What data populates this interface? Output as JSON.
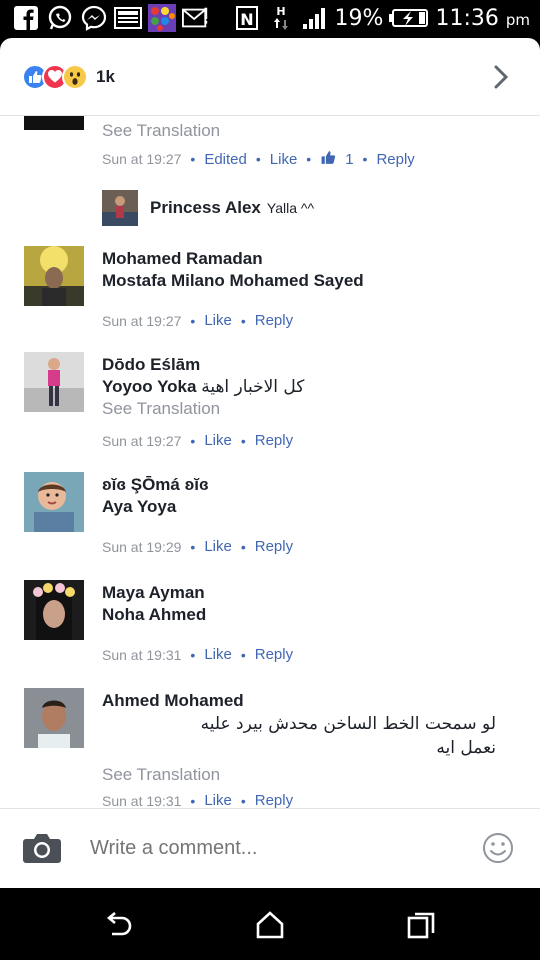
{
  "status_bar": {
    "battery": "19%",
    "time": "11:36",
    "ampm": "pm",
    "icons": [
      "facebook-icon",
      "whatsapp-icon",
      "messenger-icon",
      "news-icon",
      "game-icon",
      "mail-icon",
      "nfc-icon",
      "data-icon",
      "signal-icon",
      "battery-icon"
    ]
  },
  "header": {
    "reaction_count": "1k",
    "reactions": [
      "like",
      "love",
      "wow"
    ]
  },
  "comments": [
    {
      "see_translation": "See Translation",
      "time": "Sun at 19:27",
      "edited": "Edited",
      "like": "Like",
      "like_count": "1",
      "reply": "Reply"
    },
    {
      "name": "Princess Alex",
      "text": "Yalla ^^"
    },
    {
      "name": "Mohamed Ramadan",
      "tag": "Mostafa Milano Mohamed Sayed",
      "time": "Sun at 19:27",
      "like": "Like",
      "reply": "Reply"
    },
    {
      "name": "Dōdo Eślām",
      "tag": "Yoyoo Yoka",
      "text": "كل الاخبار اهية",
      "see_translation": "See Translation",
      "time": "Sun at 19:27",
      "like": "Like",
      "reply": "Reply"
    },
    {
      "name": "ʚĭɞ ŞŌmá ʚĭɞ",
      "tag": "Aya Yoya",
      "time": "Sun at 19:29",
      "like": "Like",
      "reply": "Reply"
    },
    {
      "name": "Maya Ayman",
      "tag": "Noha Ahmed",
      "time": "Sun at 19:31",
      "like": "Like",
      "reply": "Reply"
    },
    {
      "name": "Ahmed Mohamed",
      "text_line1": "لو سمحت الخط الساخن محدش بيرد عليه",
      "text_line2": "نعمل ايه",
      "see_translation": "See Translation",
      "time": "Sun at 19:31",
      "like": "Like",
      "reply": "Reply"
    }
  ],
  "comment_box": {
    "placeholder": "Write a comment..."
  },
  "colors": {
    "link": "#4267b2",
    "meta": "#90949c",
    "text": "#1d2129",
    "like": "#3b82f0",
    "love": "#f0364f",
    "wow": "#f7c948"
  }
}
